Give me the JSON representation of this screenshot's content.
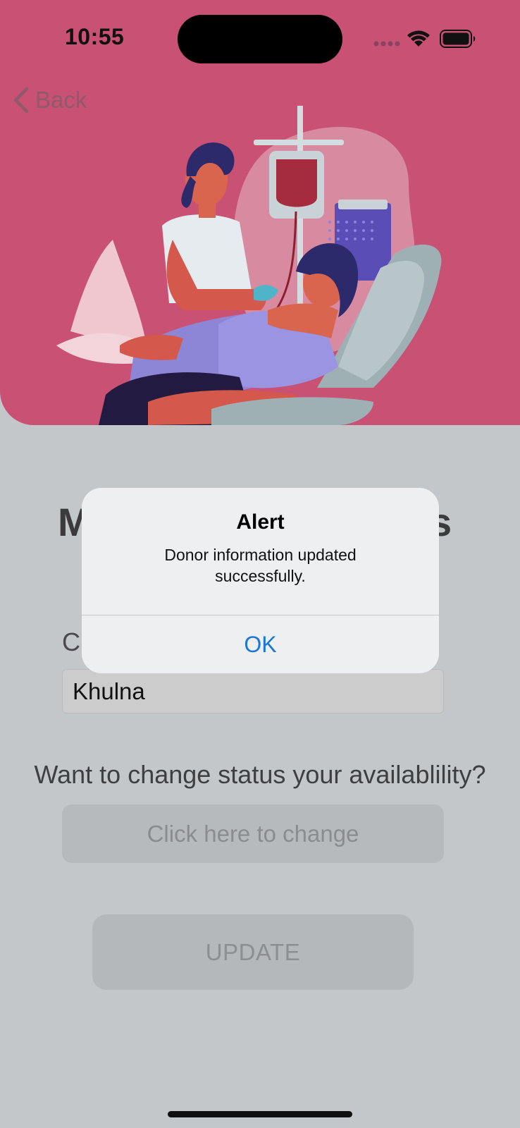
{
  "status_bar": {
    "time": "10:55"
  },
  "nav": {
    "back_label": "Back"
  },
  "form": {
    "title_visible_start": "M",
    "title_visible_end": "s",
    "city_label_visible": "C",
    "city_value": "Khulna",
    "availability_question": "Want to change status your availablility?",
    "change_button_label": "Click here to change",
    "update_button_label": "UPDATE"
  },
  "alert": {
    "title": "Alert",
    "message": "Donor information updated successfully.",
    "ok_label": "OK"
  },
  "colors": {
    "hero_background": "#c85174",
    "dimmed_background": "#c4c7ca",
    "alert_button_text": "#1a76d8"
  },
  "icons": [
    "back-chevron-icon",
    "signal-icon",
    "wifi-icon",
    "battery-icon"
  ]
}
